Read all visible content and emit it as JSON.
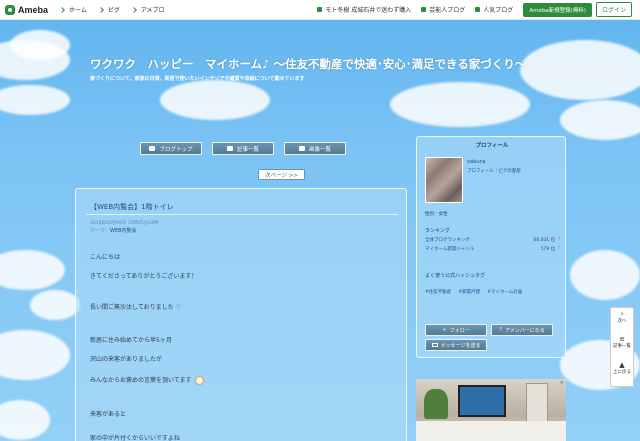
{
  "topbar": {
    "logo": "Ameba",
    "nav": [
      "ホーム",
      "ピグ",
      "アメブロ"
    ],
    "right_links": [
      "モト冬樹 成城石井で迷わず購入",
      "芸能人ブログ",
      "人気ブログ"
    ],
    "signup": "Ameba新規登録(無料)",
    "login": "ログイン"
  },
  "header": {
    "title": "ワクワク　ハッピー　マイホーム♪ 〜住友不動産で快適･安心･満足できる家づくり〜",
    "description": "家づくりについて、家族の日常、新居で使いたいインテリアや雑貨や収納について載せています"
  },
  "tabs": [
    "ブログトップ",
    "記事一覧",
    "画像一覧"
  ],
  "next_page": "次ページ >>",
  "article": {
    "title": "【WEB内覧会】1階トイレ",
    "meta": "2018年03月09日 10時45分54秒",
    "theme_label": "テーマ：",
    "theme": "WEB内覧会",
    "lines": [
      "こんにちは",
      "きてくださってありがとうございます！",
      "長い間ご無沙汰しておりました ♡",
      "新居に住み始めてから早5ヶ月",
      "沢山の来客がありましたが",
      "みんなからお褒めの言葉を頂いてます",
      "来客があると",
      "家の中が片付くからいいですよね"
    ]
  },
  "profile": {
    "heading": "プロフィール",
    "name": "sakura",
    "sub_links": "プロフィール｜ピグの部屋",
    "gender": "性別：女性",
    "ranking_heading": "ランキング",
    "rankings": [
      {
        "label": "全体ブログランキング",
        "value": "66,031 位"
      },
      {
        "label": "マイホーム新築ジャンル",
        "value": "579 位"
      }
    ],
    "hashtag_heading": "よく使う公式ハッシュタグ",
    "hashtags": [
      "#住友不動産",
      "#新築戸建",
      "#マイホーム計画"
    ],
    "follow_button": "フォロー",
    "amember_button": "アメンバーになる",
    "message_button": "メッセージを送る"
  },
  "ad": {
    "close_label": "×"
  },
  "sidenav": {
    "next": "次へ",
    "list": "記事一覧",
    "top": "上に戻る"
  },
  "colors": {
    "ameba_green": "#2d8c3c",
    "sky": "#7cc4f5",
    "link_blue": "#1f4b8c",
    "button_slate": "#5f879f"
  }
}
